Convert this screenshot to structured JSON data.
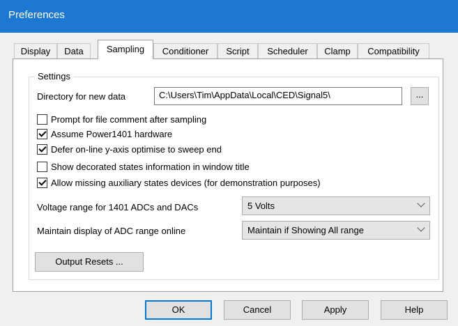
{
  "window": {
    "title": "Preferences"
  },
  "tabs": [
    {
      "label": "Display"
    },
    {
      "label": "Data"
    },
    {
      "label": "Sampling",
      "active": true
    },
    {
      "label": "Conditioner"
    },
    {
      "label": "Script"
    },
    {
      "label": "Scheduler"
    },
    {
      "label": "Clamp"
    },
    {
      "label": "Compatibility"
    }
  ],
  "settings": {
    "group_title": "Settings",
    "directory_label": "Directory for new data",
    "directory_value": "C:\\Users\\Tim\\AppData\\Local\\CED\\Signal5\\",
    "browse_label": "...",
    "checkboxes": [
      {
        "label": "Prompt for file comment after sampling",
        "checked": false
      },
      {
        "label": "Assume Power1401 hardware",
        "checked": true
      },
      {
        "label": "Defer on-line y-axis optimise to sweep end",
        "checked": true
      },
      {
        "label": "Show decorated states information in window title",
        "checked": false
      },
      {
        "label": "Allow missing auxiliary states devices (for demonstration purposes)",
        "checked": true
      }
    ],
    "voltage_label": "Voltage range for 1401 ADCs and DACs",
    "voltage_value": "5 Volts",
    "display_label": "Maintain display of ADC range online",
    "display_value": "Maintain if Showing All range",
    "output_resets_label": "Output Resets ..."
  },
  "buttons": {
    "ok": "OK",
    "cancel": "Cancel",
    "apply": "Apply",
    "help": "Help"
  }
}
